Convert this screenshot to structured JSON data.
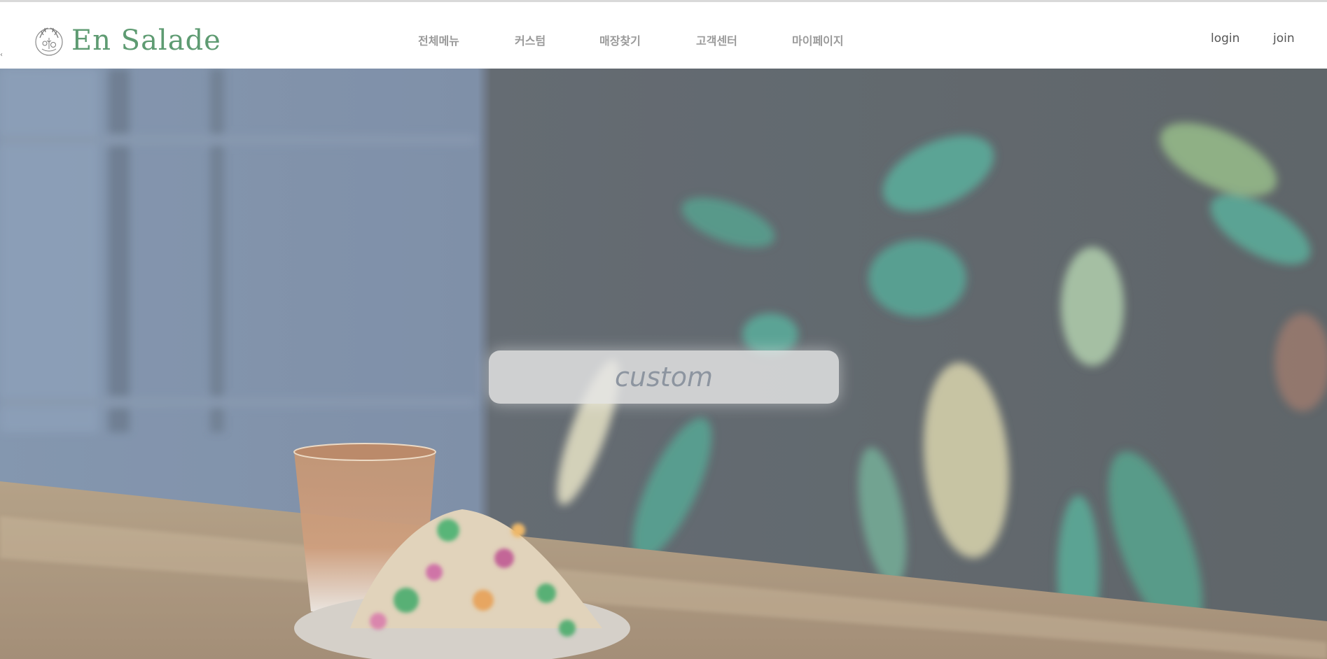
{
  "brand": {
    "name": "En Salade",
    "emblem_icon": "floral-wreath-icon",
    "color": "#5e9b72"
  },
  "nav": {
    "items": [
      {
        "label": "전체메뉴"
      },
      {
        "label": "커스텀"
      },
      {
        "label": "매장찾기"
      },
      {
        "label": "고객센터"
      },
      {
        "label": "마이페이지"
      }
    ]
  },
  "auth": {
    "login_label": "login",
    "join_label": "join"
  },
  "hero": {
    "cta_label": "custom",
    "image_subject": "iced-tea-and-salad-on-wooden-table-with-plants"
  }
}
